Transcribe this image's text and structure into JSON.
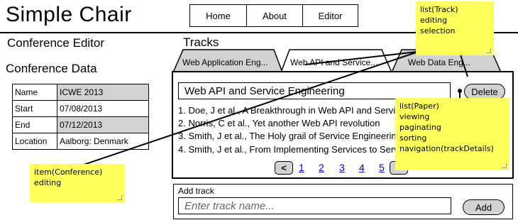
{
  "app": {
    "title": "Simple Chair"
  },
  "nav": {
    "items": [
      "Home",
      "About",
      "Editor"
    ]
  },
  "left": {
    "heading": "Conference Editor",
    "subheading": "Conference Data",
    "rows": [
      {
        "label": "Name",
        "value": "ICWE 2013"
      },
      {
        "label": "Start",
        "value": "07/08/2013"
      },
      {
        "label": "End",
        "value": "07/12/2013"
      },
      {
        "label": "Location",
        "value": "Aalborg: Denmark"
      }
    ]
  },
  "tracks": {
    "heading": "Tracks",
    "tabs": [
      "Web Application Eng...",
      "Web API and Service...",
      "Web Data Eng..."
    ],
    "current_name": "Web API and Service Engineering",
    "delete_label": "Delete",
    "papers": [
      "1. Doe, J et al., A Breakthrough in Web API and Service Engineering",
      "2. Norris, C et al., Yet another Web API revolution",
      "3. Smith, J et al., The Holy grail of Service Engineering",
      "4. Smith, J et al., From Implementing Services to Service Engineering"
    ],
    "pager": {
      "prev": "<",
      "pages": [
        "1",
        "2",
        "3",
        "4",
        "5"
      ],
      "next": ">"
    }
  },
  "add_track": {
    "label": "Add track",
    "placeholder": "Enter track name...",
    "button": "Add"
  },
  "notes": {
    "track": [
      "list(Track)",
      "editing",
      "selection"
    ],
    "paper": [
      "list(Paper)",
      "viewing",
      "paginating",
      "sorting",
      "navigation(trackDetails)"
    ],
    "conference": [
      "item(Conference)",
      "editing"
    ]
  },
  "colors": {
    "note": "#ffff5a",
    "shade": "#d2d2d2",
    "link": "#0000cc"
  }
}
